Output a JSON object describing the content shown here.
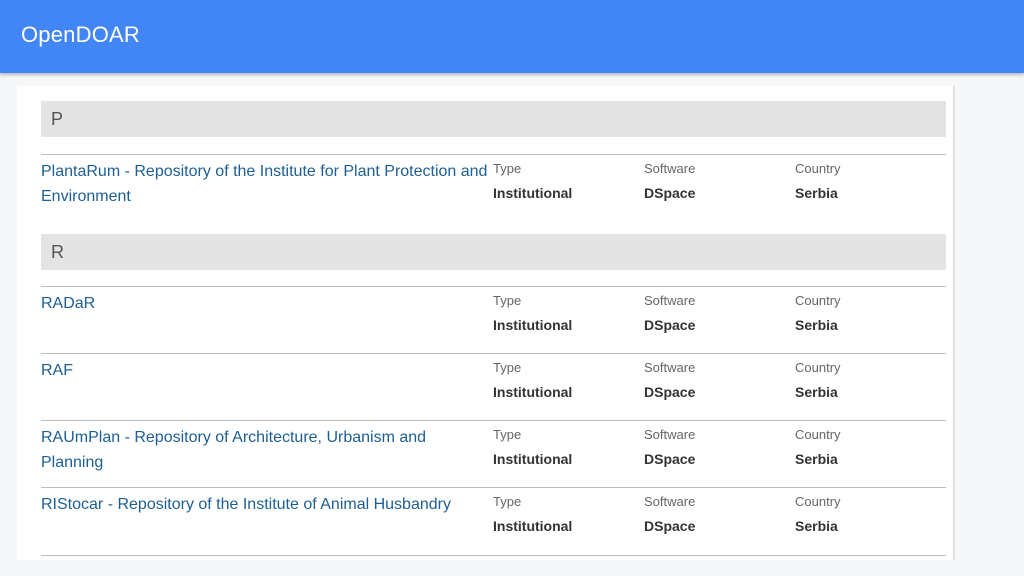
{
  "header": {
    "title": "OpenDOAR"
  },
  "labels": {
    "type": "Type",
    "software": "Software",
    "country": "Country"
  },
  "sections": [
    {
      "letter": "P",
      "items": [
        {
          "name": "PlantaRum - Repository of the Institute for Plant Protection and Environment",
          "type": "Institutional",
          "software": "DSpace",
          "country": "Serbia"
        }
      ]
    },
    {
      "letter": "R",
      "items": [
        {
          "name": "RADaR",
          "type": "Institutional",
          "software": "DSpace",
          "country": "Serbia"
        },
        {
          "name": "RAF",
          "type": "Institutional",
          "software": "DSpace",
          "country": "Serbia"
        },
        {
          "name": "RAUmPlan - Repository of Architecture, Urbanism and Planning",
          "type": "Institutional",
          "software": "DSpace",
          "country": "Serbia"
        },
        {
          "name": "RIStocar - Repository of the Institute of Animal Husbandry",
          "type": "Institutional",
          "software": "DSpace",
          "country": "Serbia"
        }
      ]
    }
  ]
}
